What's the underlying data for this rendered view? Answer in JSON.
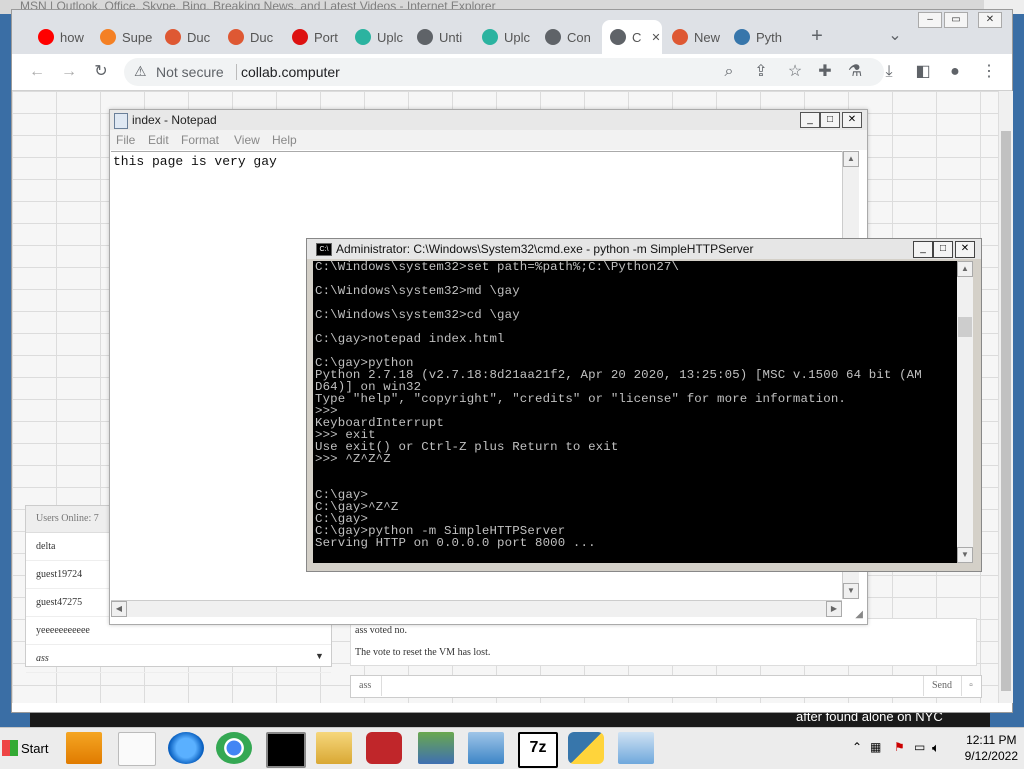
{
  "ie_title": "MSN | Outlook, Office, Skype, Bing, Breaking News, and Latest Videos - Internet Explorer",
  "tabs": [
    {
      "label": "how",
      "color": "#ff0000"
    },
    {
      "label": "Supe",
      "color": "#f48024"
    },
    {
      "label": "Duc",
      "color": "#de5833"
    },
    {
      "label": "Duc",
      "color": "#de5833"
    },
    {
      "label": "Port",
      "color": "#d11"
    },
    {
      "label": "Uplc",
      "color": "#2bb3a0"
    },
    {
      "label": "Unti",
      "color": "#5f6368"
    },
    {
      "label": "Uplc",
      "color": "#2bb3a0"
    },
    {
      "label": "Con",
      "color": "#5f6368"
    },
    {
      "label": "C",
      "color": "#5f6368"
    },
    {
      "label": "New",
      "color": "#de5833"
    },
    {
      "label": "Pyth",
      "color": "#3776ab"
    }
  ],
  "toolbar": {
    "not_secure": "Not secure",
    "url": "collab.computer"
  },
  "users_panel": {
    "header": "Users Online: 7",
    "users": [
      "delta",
      "guest19724",
      "guest47275",
      "yeeeeeeeeeee",
      "ass"
    ]
  },
  "chat": {
    "messages": [
      "ass voted no.",
      "The vote to reset the VM has lost."
    ],
    "input_value": "ass",
    "send_label": "Send"
  },
  "notepad": {
    "title": "index - Notepad",
    "menu": [
      "File",
      "Edit",
      "Format",
      "View",
      "Help"
    ],
    "content": "this page is very gay"
  },
  "cmd": {
    "title": "Administrator: C:\\Windows\\System32\\cmd.exe - python  -m SimpleHTTPServer",
    "lines": [
      "C:\\Windows\\system32>set path=%path%;C:\\Python27\\",
      "",
      "C:\\Windows\\system32>md \\gay",
      "",
      "C:\\Windows\\system32>cd \\gay",
      "",
      "C:\\gay>notepad index.html",
      "",
      "C:\\gay>python",
      "Python 2.7.18 (v2.7.18:8d21aa21f2, Apr 20 2020, 13:25:05) [MSC v.1500 64 bit (AM",
      "D64)] on win32",
      "Type \"help\", \"copyright\", \"credits\" or \"license\" for more information.",
      ">>>",
      "KeyboardInterrupt",
      ">>> exit",
      "Use exit() or Ctrl-Z plus Return to exit",
      ">>> ^Z^Z^Z",
      "",
      "",
      "C:\\gay>",
      "C:\\gay>^Z^Z",
      "C:\\gay>",
      "C:\\gay>python -m SimpleHTTPServer",
      "Serving HTTP on 0.0.0.0 port 8000 ..."
    ]
  },
  "background_strip_text": "after found alone on NYC",
  "taskbar": {
    "start_label": "Start",
    "time": "12:11 PM",
    "date": "9/12/2022"
  },
  "colors": {
    "accent_blue": "#1a73e8",
    "cmd_bg": "#000000",
    "cmd_fg": "#c0c0c0"
  }
}
